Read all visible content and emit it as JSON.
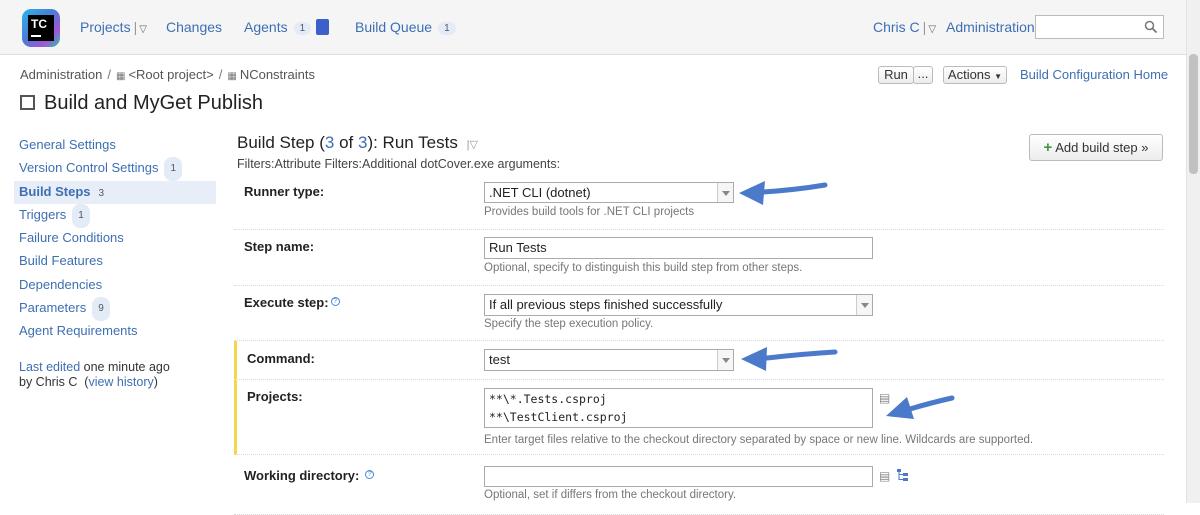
{
  "topnav": {
    "logo_text": "TC",
    "projects": "Projects",
    "changes": "Changes",
    "agents": "Agents",
    "agents_count": "1",
    "build_queue": "Build Queue",
    "build_queue_count": "1",
    "user": "Chris C",
    "administration": "Administration",
    "search_placeholder": ""
  },
  "breadcrumb": {
    "root": "Administration",
    "project": "<Root project>",
    "subproject": "NConstraints"
  },
  "page": {
    "title": "Build and MyGet Publish",
    "run": "Run",
    "run_more": "...",
    "actions": "Actions",
    "config_home": "Build Configuration Home"
  },
  "sidebar": {
    "items": [
      {
        "label": "General Settings",
        "count": ""
      },
      {
        "label": "Version Control Settings",
        "count": "1"
      },
      {
        "label": "Build Steps",
        "count": "3"
      },
      {
        "label": "Triggers",
        "count": "1"
      },
      {
        "label": "Failure Conditions",
        "count": ""
      },
      {
        "label": "Build Features",
        "count": ""
      },
      {
        "label": "Dependencies",
        "count": ""
      },
      {
        "label": "Parameters",
        "count": "9"
      },
      {
        "label": "Agent Requirements",
        "count": ""
      }
    ],
    "last_edited_link": "Last edited",
    "last_edited_time": "one minute ago",
    "by": "by Chris C",
    "view_history": "view history"
  },
  "step": {
    "title_prefix": "Build Step (",
    "current": "3",
    "of": " of ",
    "total": "3",
    "title_suffix": "): Run Tests",
    "filters": "Filters:Attribute Filters:Additional dotCover.exe arguments:",
    "add_step": "Add build step »"
  },
  "form": {
    "runner_label": "Runner type:",
    "runner_value": ".NET CLI (dotnet)",
    "runner_note": "Provides build tools for .NET CLI projects",
    "step_name_label": "Step name:",
    "step_name_value": "Run Tests",
    "step_name_note": "Optional, specify to distinguish this build step from other steps.",
    "execute_label": "Execute step:",
    "execute_value": "If all previous steps finished successfully",
    "execute_note": "Specify the step execution policy.",
    "command_label": "Command:",
    "command_value": "test",
    "projects_label": "Projects:",
    "projects_value": "**\\*.Tests.csproj\n**\\TestClient.csproj",
    "projects_note": "Enter target files relative to the checkout directory separated by space or new line. Wildcards are supported.",
    "workdir_label": "Working directory:",
    "workdir_value": "",
    "workdir_note": "Optional, set if differs from the checkout directory."
  },
  "colors": {
    "link": "#3d6fb3",
    "arrow": "#4a7ac9",
    "highlight": "#f5d64f"
  }
}
